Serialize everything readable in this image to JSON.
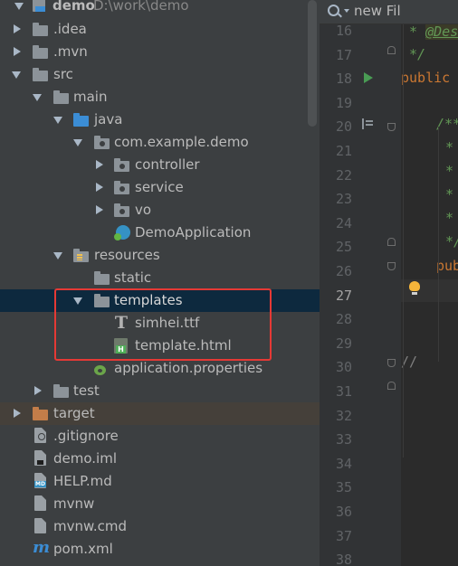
{
  "project": {
    "name": "demo",
    "path": "D:\\work\\demo"
  },
  "tree": {
    "idea": ".idea",
    "mvn": ".mvn",
    "src": "src",
    "main": "main",
    "java": "java",
    "package": "com.example.demo",
    "controller": "controller",
    "service": "service",
    "vo": "vo",
    "app_class": "DemoApplication",
    "resources": "resources",
    "static": "static",
    "templates": "templates",
    "font_file": "simhei.ttf",
    "html_file": "template.html",
    "properties": "application.properties",
    "test": "test",
    "target": "target",
    "gitignore": ".gitignore",
    "iml": "demo.iml",
    "help": "HELP.md",
    "mvnw": "mvnw",
    "mvnw_cmd": "mvnw.cmd",
    "pom": "pom.xml"
  },
  "search": {
    "text": "new Fil"
  },
  "editor": {
    "line_numbers": [
      "16",
      "17",
      "18",
      "19",
      "20",
      "21",
      "22",
      "23",
      "24",
      "25",
      "26",
      "27",
      "28",
      "29",
      "30",
      "31",
      "32",
      "33",
      "34",
      "35",
      "36",
      "37",
      "38"
    ],
    "current_line": "27",
    "code": {
      "l16_star": "* ",
      "l16_tag": "@Des",
      "l17": "*/",
      "l18": "public",
      "l20": "/**",
      "l21": "*",
      "l22": "*",
      "l23": "*",
      "l24": "*",
      "l25": "*/",
      "l26": "publ",
      "l30": "//"
    }
  },
  "colors": {
    "highlight": "#e53935",
    "selection": "#0d293e"
  }
}
